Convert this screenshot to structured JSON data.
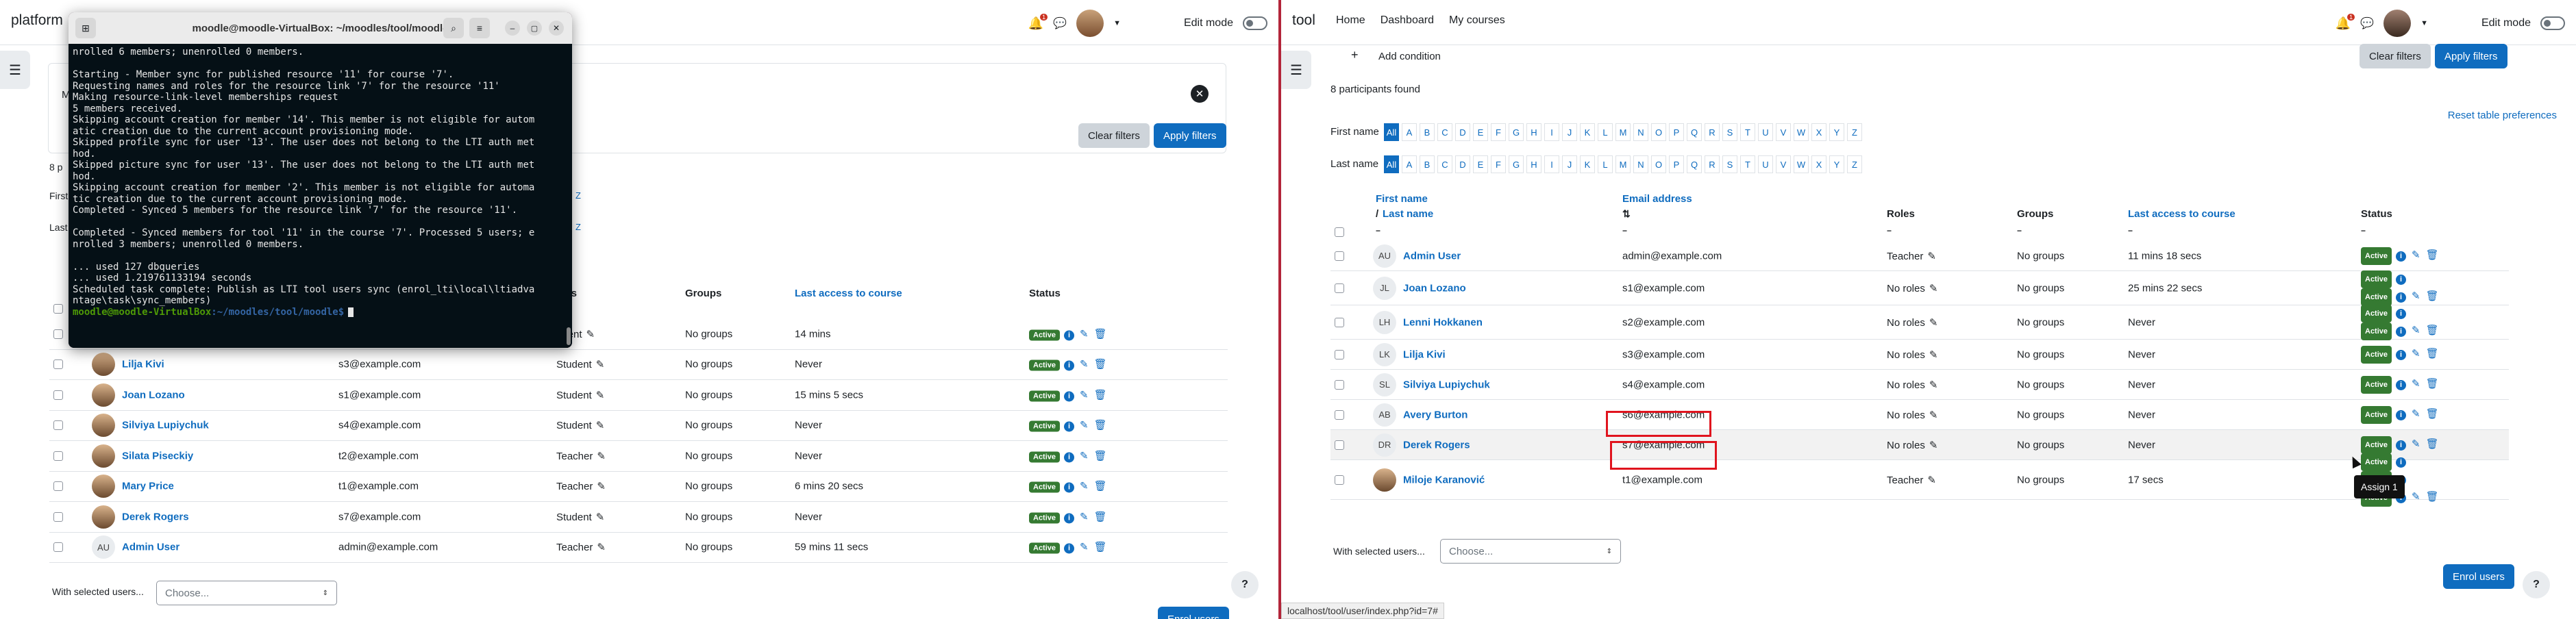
{
  "left": {
    "brand": "platform",
    "edit_mode": "Edit mode",
    "notif_count": "1",
    "buttons": {
      "clear": "Clear filters",
      "apply": "Apply filters",
      "enrol": "Enrol users"
    },
    "partial_labels": {
      "participants": "8 p",
      "first": "First",
      "last": "Last",
      "m": "M",
      "z1": "Z",
      "z2": "Z"
    },
    "columns": {
      "roles": "oles",
      "groups": "Groups",
      "last_access": "Last access to course",
      "status": "Status"
    },
    "rows": [
      {
        "name": "",
        "email": "",
        "role": "udent",
        "groups": "No groups",
        "access": "14 mins",
        "status": "Active"
      },
      {
        "name": "Lilja Kivi",
        "email": "s3@example.com",
        "role": "Student",
        "groups": "No groups",
        "access": "Never",
        "status": "Active"
      },
      {
        "name": "Joan Lozano",
        "email": "s1@example.com",
        "role": "Student",
        "groups": "No groups",
        "access": "15 mins 5 secs",
        "status": "Active"
      },
      {
        "name": "Silviya Lupiychuk",
        "email": "s4@example.com",
        "role": "Student",
        "groups": "No groups",
        "access": "Never",
        "status": "Active"
      },
      {
        "name": "Silata Piseckiy",
        "email": "t2@example.com",
        "role": "Teacher",
        "groups": "No groups",
        "access": "Never",
        "status": "Active"
      },
      {
        "name": "Mary Price",
        "email": "t1@example.com",
        "role": "Teacher",
        "groups": "No groups",
        "access": "6 mins 20 secs",
        "status": "Active"
      },
      {
        "name": "Derek Rogers",
        "email": "s7@example.com",
        "role": "Student",
        "groups": "No groups",
        "access": "Never",
        "status": "Active"
      },
      {
        "name": "Admin User",
        "initials": "AU",
        "email": "admin@example.com",
        "role": "Teacher",
        "groups": "No groups",
        "access": "59 mins 11 secs",
        "status": "Active"
      }
    ],
    "with_selected": "With selected users...",
    "choose": "Choose...",
    "help": "?"
  },
  "terminal": {
    "title": "moodle@moodle-VirtualBox: ~/moodles/tool/moodle",
    "lines": [
      "nrolled 6 members; unenrolled 0 members.",
      "",
      "Starting - Member sync for published resource '11' for course '7'.",
      "Requesting names and roles for the resource link '7' for the resource '11'",
      "Making resource-link-level memberships request",
      "5 members received.",
      "Skipping account creation for member '14'. This member is not eligible for autom",
      "atic creation due to the current account provisioning mode.",
      "Skipped profile sync for user '13'. The user does not belong to the LTI auth met",
      "hod.",
      "Skipped picture sync for user '13'. The user does not belong to the LTI auth met",
      "hod.",
      "Skipping account creation for member '2'. This member is not eligible for automa",
      "tic creation due to the current account provisioning mode.",
      "Completed - Synced 5 members for the resource link '7' for the resource '11'.",
      "",
      "Completed - Synced members for tool '11' in the course '7'. Processed 5 users; e",
      "nrolled 3 members; unenrolled 0 members.",
      "",
      "... used 127 dbqueries",
      "... used 1.219761133194 seconds",
      "Scheduled task complete: Publish as LTI tool users sync (enrol_lti\\local\\ltiadva",
      "ntage\\task\\sync_members)"
    ],
    "prompt_user": "moodle@moodle-VirtualBox",
    "prompt_path": ":~/moodles/tool/moodle$"
  },
  "right": {
    "brand": "tool",
    "nav": [
      "Home",
      "Dashboard",
      "My courses"
    ],
    "edit_mode": "Edit mode",
    "notif_count": "1",
    "add_condition": "Add condition",
    "buttons": {
      "clear": "Clear filters",
      "apply": "Apply filters",
      "enrol": "Enrol users"
    },
    "participants_found": "8 participants found",
    "reset": "Reset table preferences",
    "first_name_label": "First name",
    "last_name_label": "Last name",
    "letters": [
      "All",
      "A",
      "B",
      "C",
      "D",
      "E",
      "F",
      "G",
      "H",
      "I",
      "J",
      "K",
      "L",
      "M",
      "N",
      "O",
      "P",
      "Q",
      "R",
      "S",
      "T",
      "U",
      "V",
      "W",
      "X",
      "Y",
      "Z"
    ],
    "columns": {
      "first": "First name",
      "slash": "/",
      "last": "Last name",
      "email": "Email address",
      "roles": "Roles",
      "groups": "Groups",
      "last_access": "Last access to course",
      "status": "Status"
    },
    "rows": [
      {
        "initials": "AU",
        "name": "Admin User",
        "email": "admin@example.com",
        "role": "Teacher",
        "groups": "No groups",
        "access": "11 mins 18 secs",
        "status": "Active"
      },
      {
        "initials": "JL",
        "name": "Joan Lozano",
        "email": "s1@example.com",
        "role": "No roles",
        "groups": "No groups",
        "access": "25 mins 22 secs",
        "status": "Active",
        "status2": "Active"
      },
      {
        "initials": "LH",
        "name": "Lenni Hokkanen",
        "email": "s2@example.com",
        "role": "No roles",
        "groups": "No groups",
        "access": "Never",
        "status": "Active",
        "status2": "Active"
      },
      {
        "initials": "LK",
        "name": "Lilja Kivi",
        "email": "s3@example.com",
        "role": "No roles",
        "groups": "No groups",
        "access": "Never",
        "status": "Active"
      },
      {
        "initials": "SL",
        "name": "Silviya Lupiychuk",
        "email": "s4@example.com",
        "role": "No roles",
        "groups": "No groups",
        "access": "Never",
        "status": "Active"
      },
      {
        "initials": "AB",
        "name": "Avery Burton",
        "email": "s6@example.com",
        "role": "No roles",
        "groups": "No groups",
        "access": "Never",
        "status": "Active"
      },
      {
        "initials": "DR",
        "name": "Derek Rogers",
        "email": "s7@example.com",
        "role": "No roles",
        "groups": "No groups",
        "access": "Never",
        "status": "Active"
      },
      {
        "name": "Miloje Karanović",
        "email": "t1@example.com",
        "role": "Teacher",
        "groups": "No groups",
        "access": "17 secs",
        "status": "Active",
        "status2": "Active",
        "status3": "Active"
      }
    ],
    "tooltip": "Assign 1",
    "with_selected": "With selected users...",
    "choose": "Choose...",
    "help": "?",
    "status_url": "localhost/tool/user/index.php?id=7#"
  }
}
